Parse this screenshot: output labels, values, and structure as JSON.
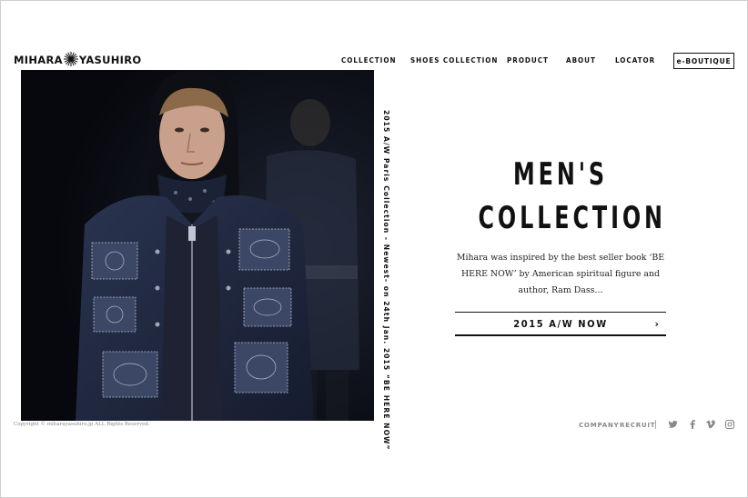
{
  "brand": {
    "left": "MIHARA",
    "right": "YASUHIRO"
  },
  "nav": {
    "items": [
      {
        "label": "COLLECTION"
      },
      {
        "label": "SHOES COLLECTION"
      },
      {
        "label": "PRODUCT"
      },
      {
        "label": "ABOUT"
      },
      {
        "label": "LOCATOR"
      }
    ],
    "eboutique_label": "e-BOUTIQUE"
  },
  "hero": {
    "vertical_caption": "2015 A/W Paris Collection - Newest- on 24th Jan. 2015 “BE HERE NOW”",
    "headline_line1": "MEN'S",
    "headline_line2": "COLLECTION",
    "description": "Mihara was inspired by the best seller book ‘BE HERE NOW’ by American spiritual figure and author, Ram Dass...",
    "cta_label": "2015 A/W NOW",
    "cta_arrow": "›"
  },
  "footer": {
    "copyright": "Copyright © miharayasuhiro.jp ALL Rights Reserved.",
    "links": [
      "COMPANY",
      "RECRUIT"
    ],
    "social": [
      "twitter-icon",
      "facebook-icon",
      "vimeo-icon",
      "instagram-icon"
    ]
  },
  "colors": {
    "text": "#111111",
    "muted": "#888888",
    "background": "#ffffff"
  }
}
